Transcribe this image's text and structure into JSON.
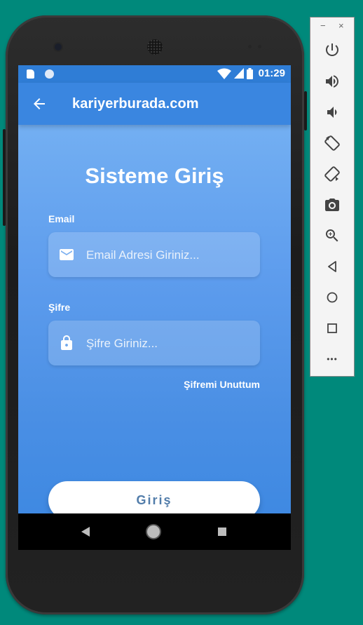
{
  "status_bar": {
    "time": "01:29",
    "icons": [
      "sd-card-icon",
      "sync-circle-icon",
      "wifi-icon",
      "signal-icon",
      "battery-icon"
    ]
  },
  "app_bar": {
    "title": "kariyerburada.com",
    "back_icon": "arrow-left-icon"
  },
  "login": {
    "heading": "Sisteme Giriş",
    "email_label": "Email",
    "email_placeholder": "Email Adresi Giriniz...",
    "email_value": "",
    "password_label": "Şifre",
    "password_placeholder": "Şifre Giriniz...",
    "password_value": "",
    "forgot_label": "Şifremi Unuttum",
    "submit_label": "Giriş"
  },
  "nav_bar": {
    "buttons": [
      "back-triangle-icon",
      "home-circle-icon",
      "recent-square-icon"
    ]
  },
  "emulator_toolbar": {
    "window_controls": [
      "−",
      "×"
    ],
    "buttons": [
      "power-icon",
      "volume-up-icon",
      "volume-down-icon",
      "rotate-left-icon",
      "rotate-right-icon",
      "camera-icon",
      "zoom-icon",
      "back-icon",
      "home-icon",
      "overview-icon",
      "more-icon"
    ],
    "more_label": "•••"
  },
  "colors": {
    "background": "#00897b",
    "status_bar": "#2f7dd6",
    "app_bar": "#3a86e0",
    "gradient_top": "#73aff2",
    "gradient_bottom": "#3f89e2",
    "button_text": "#527daa"
  }
}
